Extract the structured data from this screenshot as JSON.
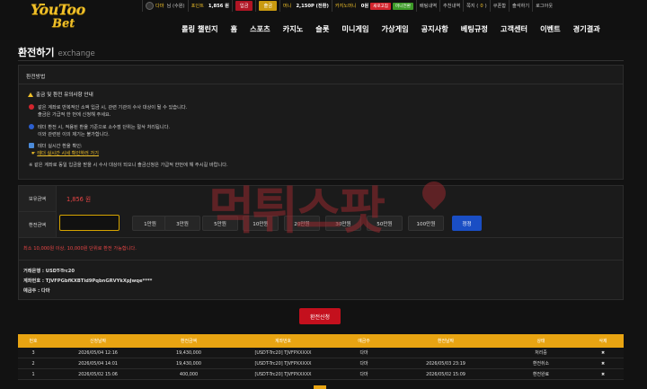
{
  "brand": {
    "line1": "YouToo",
    "line2": "Bet"
  },
  "userbar": {
    "level_name": "다마",
    "level_suffix": "님 (수원)",
    "point_label": "포인트",
    "point_value": "1,856 원",
    "deposit": "입금",
    "withdraw": "출금",
    "money_label": "머니",
    "money_value": "2,150P (전환)",
    "casino_label": "카지노머니",
    "casino_value": "0원",
    "badge_refresh": "새로고침",
    "badge_mini": "머니전환",
    "betting_history": "배팅내역",
    "recommend": "추천내역",
    "notes_label": "쪽지 (",
    "notes_count": "0",
    "notes_close": ")",
    "coupon": "쿠폰함",
    "attendance": "출석하기",
    "logout": "로그아웃"
  },
  "nav": [
    "롤링 챌린지",
    "홈",
    "스포츠",
    "카지노",
    "슬롯",
    "미니게임",
    "가상게임",
    "공지사항",
    "베팅규정",
    "고객센터",
    "이벤트",
    "경기결과"
  ],
  "page": {
    "title": "환전하기",
    "subtitle": "exchange"
  },
  "method": {
    "header": "환전방법",
    "sub": "출금 및 환전 유의사항 안내",
    "l1": "같은 계좌로 반복적인 소액 입금 시, 관련 기관의 수사 대상이 될 수 있습니다.",
    "l2": "출금은 가급적 한 번에 신청해 주세요.",
    "l3": "테더 환전 시, 적용된 환율 기준으로 소수점 단위는 절삭 처리됩니다.",
    "l4": "이와 관련된 이의 제기는 불가합니다.",
    "l5": "테더 실시간 환율 확인:",
    "l6": "테더 실시간 시세 확인하러 가기",
    "l7": "※ 같은 계좌로 동일 입금을 받을 시 수사 대상이 되오니 출금신청은 가급적 한번에 해 주시길 바랍니다."
  },
  "form": {
    "balance_label": "보유금액",
    "balance_value": "1,856 원",
    "amount_label": "환전금액",
    "amount_value": "",
    "quick": [
      "1만원",
      "3만원",
      "5만원",
      "10만원",
      "20만원",
      "30만원",
      "50만원",
      "100만원"
    ],
    "confirm": "정정",
    "notice": "최소 10,000원 이상, 10,000원 단위로 환전 가능합니다.",
    "bank": "거래은행 : USDT-Trc20",
    "account": "계좌번호 : TJVFPGbfKXBTid9PqbnGRVYkXpJwqe****",
    "holder": "예금주 : 다마"
  },
  "submit": "환전신청",
  "table": {
    "headers": [
      "번호",
      "신청날짜",
      "환전금액",
      "계좌번호",
      "예금주",
      "환전날짜",
      "상태",
      "삭제"
    ],
    "rows": [
      [
        "3",
        "2026/05/04 12:16",
        "19,430,000",
        "[USDT-Trc20] TJVFPXXXXX",
        "다마",
        "",
        "처리중",
        "✖"
      ],
      [
        "2",
        "2026/05/04 14:01",
        "19,430,000",
        "[USDT-Trc20] TJVFPXXXXX",
        "다마",
        "2026/05/03 23:19",
        "환전취소",
        "✖"
      ],
      [
        "1",
        "2026/05/02 15:06",
        "400,000",
        "[USDT-Trc20] TJVFPXXXXX",
        "다마",
        "2026/05/02 15:09",
        "환전완료",
        "✖"
      ]
    ]
  },
  "watermark": "먹튀스팟",
  "colors": {
    "accent": "#e8a412",
    "danger": "#c4101d",
    "primary": "#1a4ec4"
  }
}
